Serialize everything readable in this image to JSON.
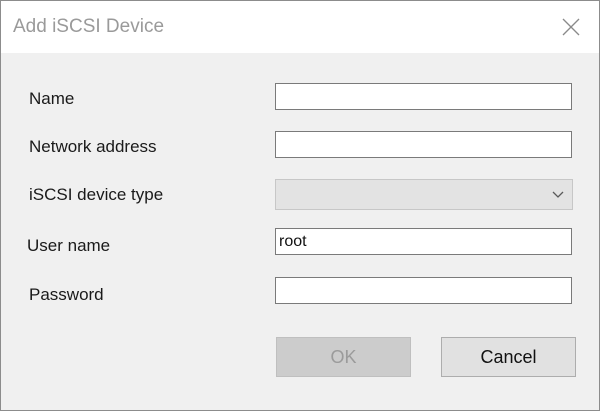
{
  "window": {
    "title": "Add iSCSI Device",
    "close_icon": "close-icon"
  },
  "form": {
    "name_label": "Name",
    "name_value": "",
    "network_address_label": "Network address",
    "network_address_value": "",
    "device_type_label": "iSCSI device type",
    "device_type_value": "",
    "dropdown_icon": "chevron-down-icon",
    "user_name_label": "User name",
    "user_name_value": "root",
    "password_label": "Password",
    "password_value": ""
  },
  "buttons": {
    "ok_label": "OK",
    "cancel_label": "Cancel"
  }
}
